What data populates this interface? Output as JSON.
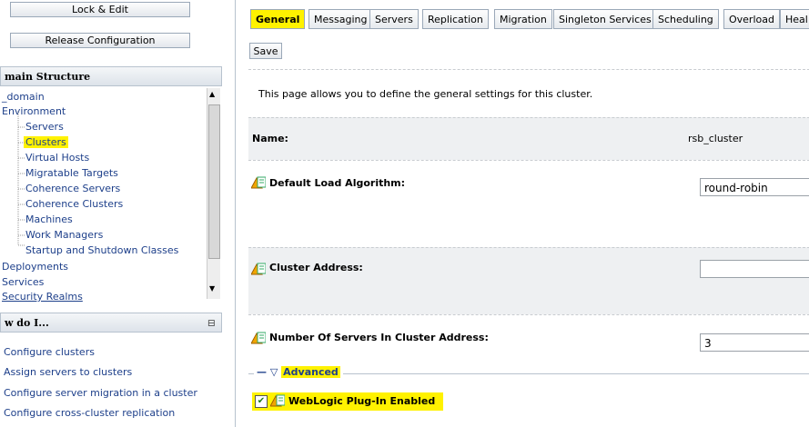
{
  "left": {
    "buttons": {
      "lock_edit": "Lock & Edit",
      "release": "Release Configuration"
    },
    "structure_title": "main Structure",
    "tree": [
      "_domain",
      "Environment",
      "Servers",
      "Clusters",
      "Virtual Hosts",
      "Migratable Targets",
      "Coherence Servers",
      "Coherence Clusters",
      "Machines",
      "Work Managers",
      "Startup and Shutdown Classes",
      "Deployments",
      "Services",
      "Security Realms"
    ],
    "howdo_title": "w do I...",
    "links": [
      "Configure clusters",
      "Assign servers to clusters",
      "Configure server migration in a cluster",
      "Configure cross-cluster replication"
    ]
  },
  "tabs": [
    "General",
    "Messaging",
    "Servers",
    "Replication",
    "Migration",
    "Singleton Services",
    "Scheduling",
    "Overload",
    "Heal"
  ],
  "save_label": "Save",
  "intro": "This page allows you to define the general settings for this cluster.",
  "name_label": "Name:",
  "name_value": "rsb_cluster",
  "default_load_label": "Default Load Algorithm:",
  "default_load_value": "round-robin",
  "cluster_address_label": "Cluster Address:",
  "cluster_address_value": "",
  "num_servers_label": "Number Of Servers In Cluster Address:",
  "num_servers_value": "3",
  "advanced_label": "Advanced",
  "plugin_label": "WebLogic Plug-In Enabled",
  "plugin_checked": true,
  "colors": {
    "highlight": "#fff200",
    "link": "#1d3f8a"
  }
}
